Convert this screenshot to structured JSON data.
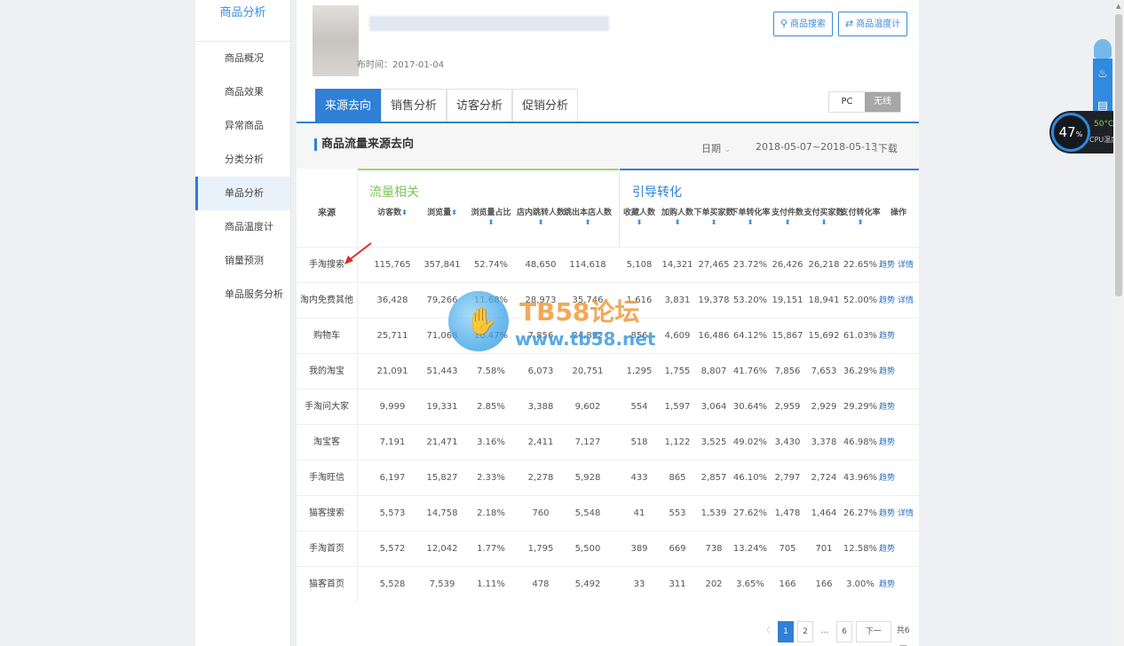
{
  "sidebar": {
    "title": "商品分析",
    "items": [
      "商品概况",
      "商品效果",
      "异常商品",
      "分类分析",
      "单品分析",
      "商品温度计",
      "销量预测",
      "单品服务分析"
    ],
    "active_index": 4
  },
  "header": {
    "publish_date": "布时间：2017-01-04",
    "btn_search": "商品搜索",
    "btn_thermometer": "商品温度计"
  },
  "tabs": [
    "来源去向",
    "销售分析",
    "访客分析",
    "促销分析"
  ],
  "device": {
    "pc": "PC",
    "wireless": "无线"
  },
  "section": {
    "title": "商品流量来源去向",
    "date_label": "日期",
    "date_range": "2018-05-07~2018-05-13",
    "download": "下载"
  },
  "groups": {
    "traffic": "流量相关",
    "conversion": "引导转化"
  },
  "table": {
    "source_header": "来源",
    "headers": [
      "访客数",
      "浏览量",
      "浏览量占比",
      "店内跳转人数",
      "跳出本店人数",
      "收藏人数",
      "加购人数",
      "下单买家数",
      "下单转化率",
      "支付件数",
      "支付买家数",
      "支付转化率",
      "操作"
    ],
    "rows": [
      {
        "src": "手淘搜索",
        "v": [
          "115,765",
          "357,841",
          "52.74%",
          "48,650",
          "114,618",
          "5,108",
          "14,321",
          "27,465",
          "23.72%",
          "26,426",
          "26,218",
          "22.65%"
        ],
        "ops": [
          "趋势",
          "详情"
        ]
      },
      {
        "src": "淘内免费其他",
        "v": [
          "36,428",
          "79,266",
          "11.68%",
          "28,973",
          "35,746",
          "1,616",
          "3,831",
          "19,378",
          "53.20%",
          "19,151",
          "18,941",
          "52.00%"
        ],
        "ops": [
          "趋势",
          "详情"
        ]
      },
      {
        "src": "购物车",
        "v": [
          "25,711",
          "71,068",
          "10.47%",
          "7,856",
          "24,892",
          "856",
          "4,609",
          "16,486",
          "64.12%",
          "15,867",
          "15,692",
          "61.03%"
        ],
        "ops": [
          "趋势"
        ]
      },
      {
        "src": "我的淘宝",
        "v": [
          "21,091",
          "51,443",
          "7.58%",
          "6,073",
          "20,751",
          "1,295",
          "1,755",
          "8,807",
          "41.76%",
          "7,856",
          "7,653",
          "36.29%"
        ],
        "ops": [
          "趋势"
        ]
      },
      {
        "src": "手淘问大家",
        "v": [
          "9,999",
          "19,331",
          "2.85%",
          "3,388",
          "9,602",
          "554",
          "1,597",
          "3,064",
          "30.64%",
          "2,959",
          "2,929",
          "29.29%"
        ],
        "ops": [
          "趋势"
        ]
      },
      {
        "src": "淘宝客",
        "v": [
          "7,191",
          "21,471",
          "3.16%",
          "2,411",
          "7,127",
          "518",
          "1,122",
          "3,525",
          "49.02%",
          "3,430",
          "3,378",
          "46.98%"
        ],
        "ops": [
          "趋势"
        ]
      },
      {
        "src": "手淘旺信",
        "v": [
          "6,197",
          "15,827",
          "2.33%",
          "2,278",
          "5,928",
          "433",
          "865",
          "2,857",
          "46.10%",
          "2,797",
          "2,724",
          "43.96%"
        ],
        "ops": [
          "趋势"
        ]
      },
      {
        "src": "猫客搜索",
        "v": [
          "5,573",
          "14,758",
          "2.18%",
          "760",
          "5,548",
          "41",
          "553",
          "1,539",
          "27.62%",
          "1,478",
          "1,464",
          "26.27%"
        ],
        "ops": [
          "趋势",
          "详情"
        ]
      },
      {
        "src": "手淘首页",
        "v": [
          "5,572",
          "12,042",
          "1.77%",
          "1,795",
          "5,500",
          "389",
          "669",
          "738",
          "13.24%",
          "705",
          "701",
          "12.58%"
        ],
        "ops": [
          "趋势"
        ]
      },
      {
        "src": "猫客首页",
        "v": [
          "5,528",
          "7,539",
          "1.11%",
          "478",
          "5,492",
          "33",
          "311",
          "202",
          "3.65%",
          "166",
          "166",
          "3.00%"
        ],
        "ops": [
          "趋势"
        ]
      }
    ]
  },
  "pager": {
    "prev": "〈",
    "pages": [
      "1",
      "2",
      "...",
      "6"
    ],
    "next": "下一页〉",
    "total": "共6页",
    "current": "1"
  },
  "watermark": {
    "brand": "TB58论坛",
    "url": "www.tb58.net"
  },
  "cpu_widget": {
    "percent": "47",
    "percent_unit": "%",
    "temp": "50°C",
    "label": "CPU温度"
  },
  "colors": {
    "accent": "#2f80d6",
    "traffic_green": "#9ed36a",
    "group_label_green": "#7cc35a",
    "group_label_blue": "#2f80d6"
  }
}
